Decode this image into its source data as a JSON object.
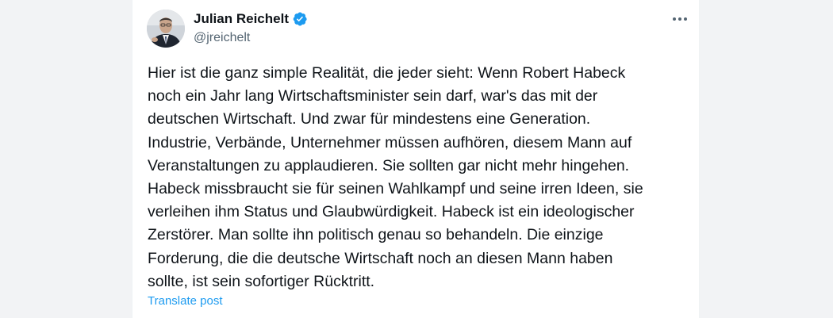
{
  "post": {
    "author": {
      "name": "Julian Reichelt",
      "handle": "@jreichelt",
      "verified": true,
      "verified_icon": "verified-badge-icon",
      "avatar_icon": "avatar-photo"
    },
    "more_icon": "more-options-icon",
    "text_lines": [
      "Hier ist die ganz simple Realität, die jeder sieht: Wenn Robert Habeck",
      "noch ein Jahr lang Wirtschaftsminister sein darf, war's das mit der",
      "deutschen Wirtschaft. Und zwar für mindestens eine Generation.",
      "Industrie, Verbände, Unternehmer müssen aufhören, diesem Mann auf",
      "Veranstaltungen zu applaudieren. Sie sollten gar nicht mehr hingehen.",
      "Habeck missbraucht sie für seinen Wahlkampf und seine irren Ideen, sie",
      "verleihen ihm Status und Glaubwürdigkeit. Habeck ist ein ideologischer",
      "Zerstörer. Man sollte ihn politisch genau so behandeln. Die einzige",
      "Forderung, die die deutsche Wirtschaft noch an diesen Mann haben",
      "sollte, ist sein sofortiger Rücktritt."
    ],
    "translate_label": "Translate post"
  },
  "colors": {
    "verified_blue": "#1d9bf0",
    "text_primary": "#0f1419",
    "text_secondary": "#536471",
    "link": "#1d9bf0"
  }
}
